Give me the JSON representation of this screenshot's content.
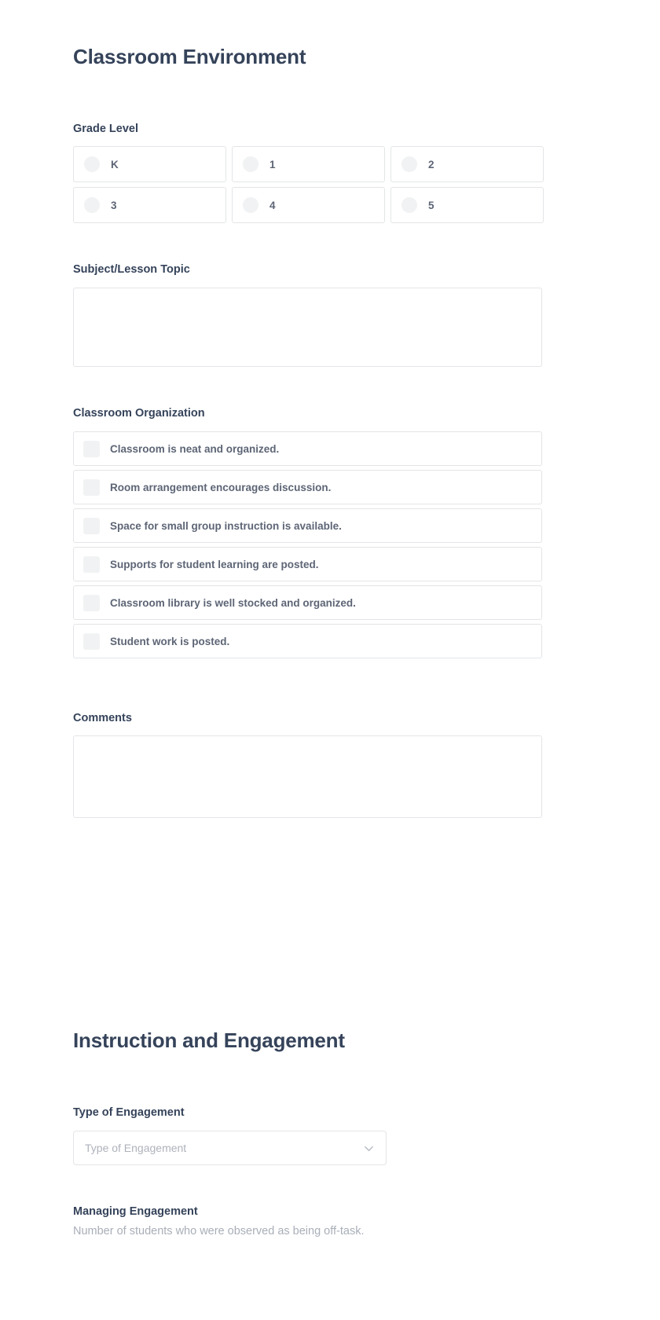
{
  "sections": [
    {
      "title": "Classroom Environment",
      "grade_level": {
        "label": "Grade Level",
        "options": [
          "K",
          "1",
          "2",
          "3",
          "4",
          "5"
        ]
      },
      "subject": {
        "label": "Subject/Lesson Topic",
        "value": "",
        "placeholder": ""
      },
      "classroom_organization": {
        "label": "Classroom Organization",
        "items": [
          "Classroom is neat and organized.",
          "Room arrangement encourages discussion.",
          "Space for small group instruction is available.",
          "Supports for student learning are posted.",
          "Classroom library is well stocked and organized.",
          "Student work is posted."
        ]
      },
      "comments": {
        "label": "Comments",
        "value": "",
        "placeholder": ""
      }
    },
    {
      "title": "Instruction and Engagement",
      "type_of_engagement": {
        "label": "Type of Engagement",
        "placeholder": "Type of Engagement",
        "value": "",
        "chevron": "chevron-down-icon"
      },
      "managing_engagement": {
        "label": "Managing Engagement",
        "sublabel": "Number of students who were observed as being off-task."
      }
    }
  ],
  "colors": {
    "heading": "#35435a",
    "body_text": "#5d6575",
    "muted_text": "#aeb2bb",
    "border": "#e3e5e8",
    "control_fill": "#f1f2f3",
    "background": "#ffffff"
  }
}
